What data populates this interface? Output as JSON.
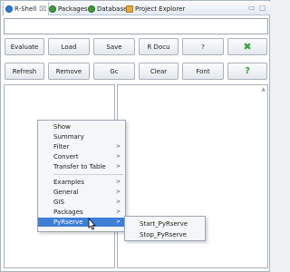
{
  "tabs": [
    {
      "label": "R-Shell",
      "icon": "r-shell-icon",
      "active": true,
      "close": "⌧"
    },
    {
      "label": "Packages",
      "icon": "packages-icon"
    },
    {
      "label": "Database",
      "icon": "database-icon"
    },
    {
      "label": "Project Explorer",
      "icon": "project-explorer-icon"
    }
  ],
  "window_controls": {
    "minimize": "▭",
    "maximize": "▢"
  },
  "command_input": {
    "value": "",
    "placeholder": ""
  },
  "toolbar_row1": [
    "Evaluate",
    "Load",
    "Save",
    "R Docu",
    "?"
  ],
  "toolbar_row2": [
    "Refresh",
    "Remove",
    "Gc",
    "Clear",
    "Font"
  ],
  "icons": {
    "clear_all": "✖",
    "help": "?"
  },
  "colors": {
    "accent_green": "#39a03a",
    "selection_blue": "#3d7fd7"
  },
  "context_menu": {
    "group1": [
      {
        "label": "Show",
        "submenu": false
      },
      {
        "label": "Summary",
        "submenu": false
      },
      {
        "label": "Filter",
        "submenu": true
      },
      {
        "label": "Convert",
        "submenu": true
      },
      {
        "label": "Transfer to Table",
        "submenu": true
      }
    ],
    "group2": [
      {
        "label": "Examples",
        "submenu": true
      },
      {
        "label": "General",
        "submenu": true
      },
      {
        "label": "GIS",
        "submenu": true
      },
      {
        "label": "Packages",
        "submenu": true
      },
      {
        "label": "PyRserve",
        "submenu": true,
        "selected": true
      }
    ],
    "arrow": ">"
  },
  "submenu": [
    "Start_PyRserve",
    "Stop_PyRserve"
  ]
}
